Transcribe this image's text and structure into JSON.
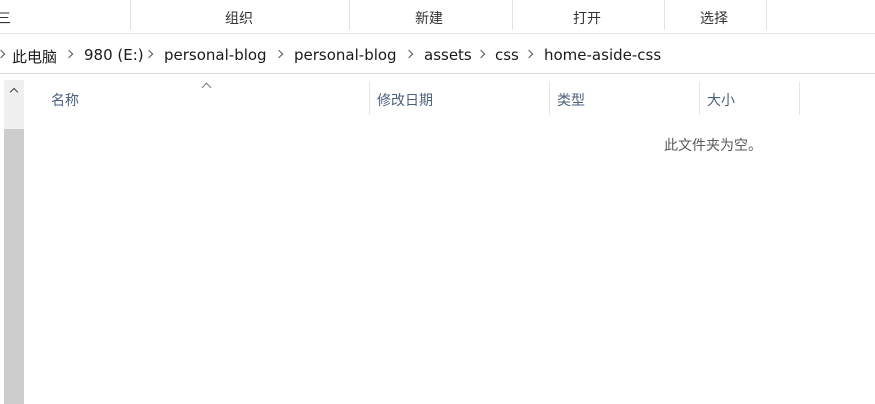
{
  "ribbon": {
    "edge_fragment": "三",
    "groups": [
      "组织",
      "新建",
      "打开",
      "选择"
    ]
  },
  "breadcrumb": {
    "items": [
      "此电脑",
      "980 (E:)",
      "personal-blog",
      "personal-blog",
      "assets",
      "css",
      "home-aside-css"
    ]
  },
  "columns": {
    "name": "名称",
    "date_modified": "修改日期",
    "type": "类型",
    "size": "大小"
  },
  "empty_message": "此文件夹为空。",
  "colors": {
    "header_text": "#4c607a",
    "scrollbar_thumb": "#cdcdcd",
    "scrollbar_track": "#f0f0f0"
  }
}
